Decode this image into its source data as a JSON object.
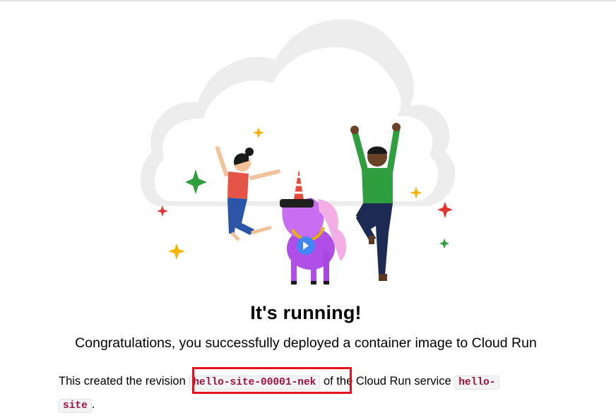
{
  "main": {
    "title": "It's running!",
    "subtitle": "Congratulations, you successfully deployed a container image to Cloud Run",
    "revision_prefix": "This created the revision ",
    "revision_name": "hello-site-00001-nek",
    "service_text": " of the Cloud Run service ",
    "service_name_line1": "hello-",
    "service_name_line2": "site",
    "period": "."
  },
  "illustration": {
    "description_icons": [
      "cloud-icon",
      "unicorn-icon",
      "cloud-run-logo-icon"
    ]
  },
  "colors": {
    "code_text": "#a0103c",
    "highlight_border": "#e4101d",
    "cloud": "#eeeeee"
  }
}
